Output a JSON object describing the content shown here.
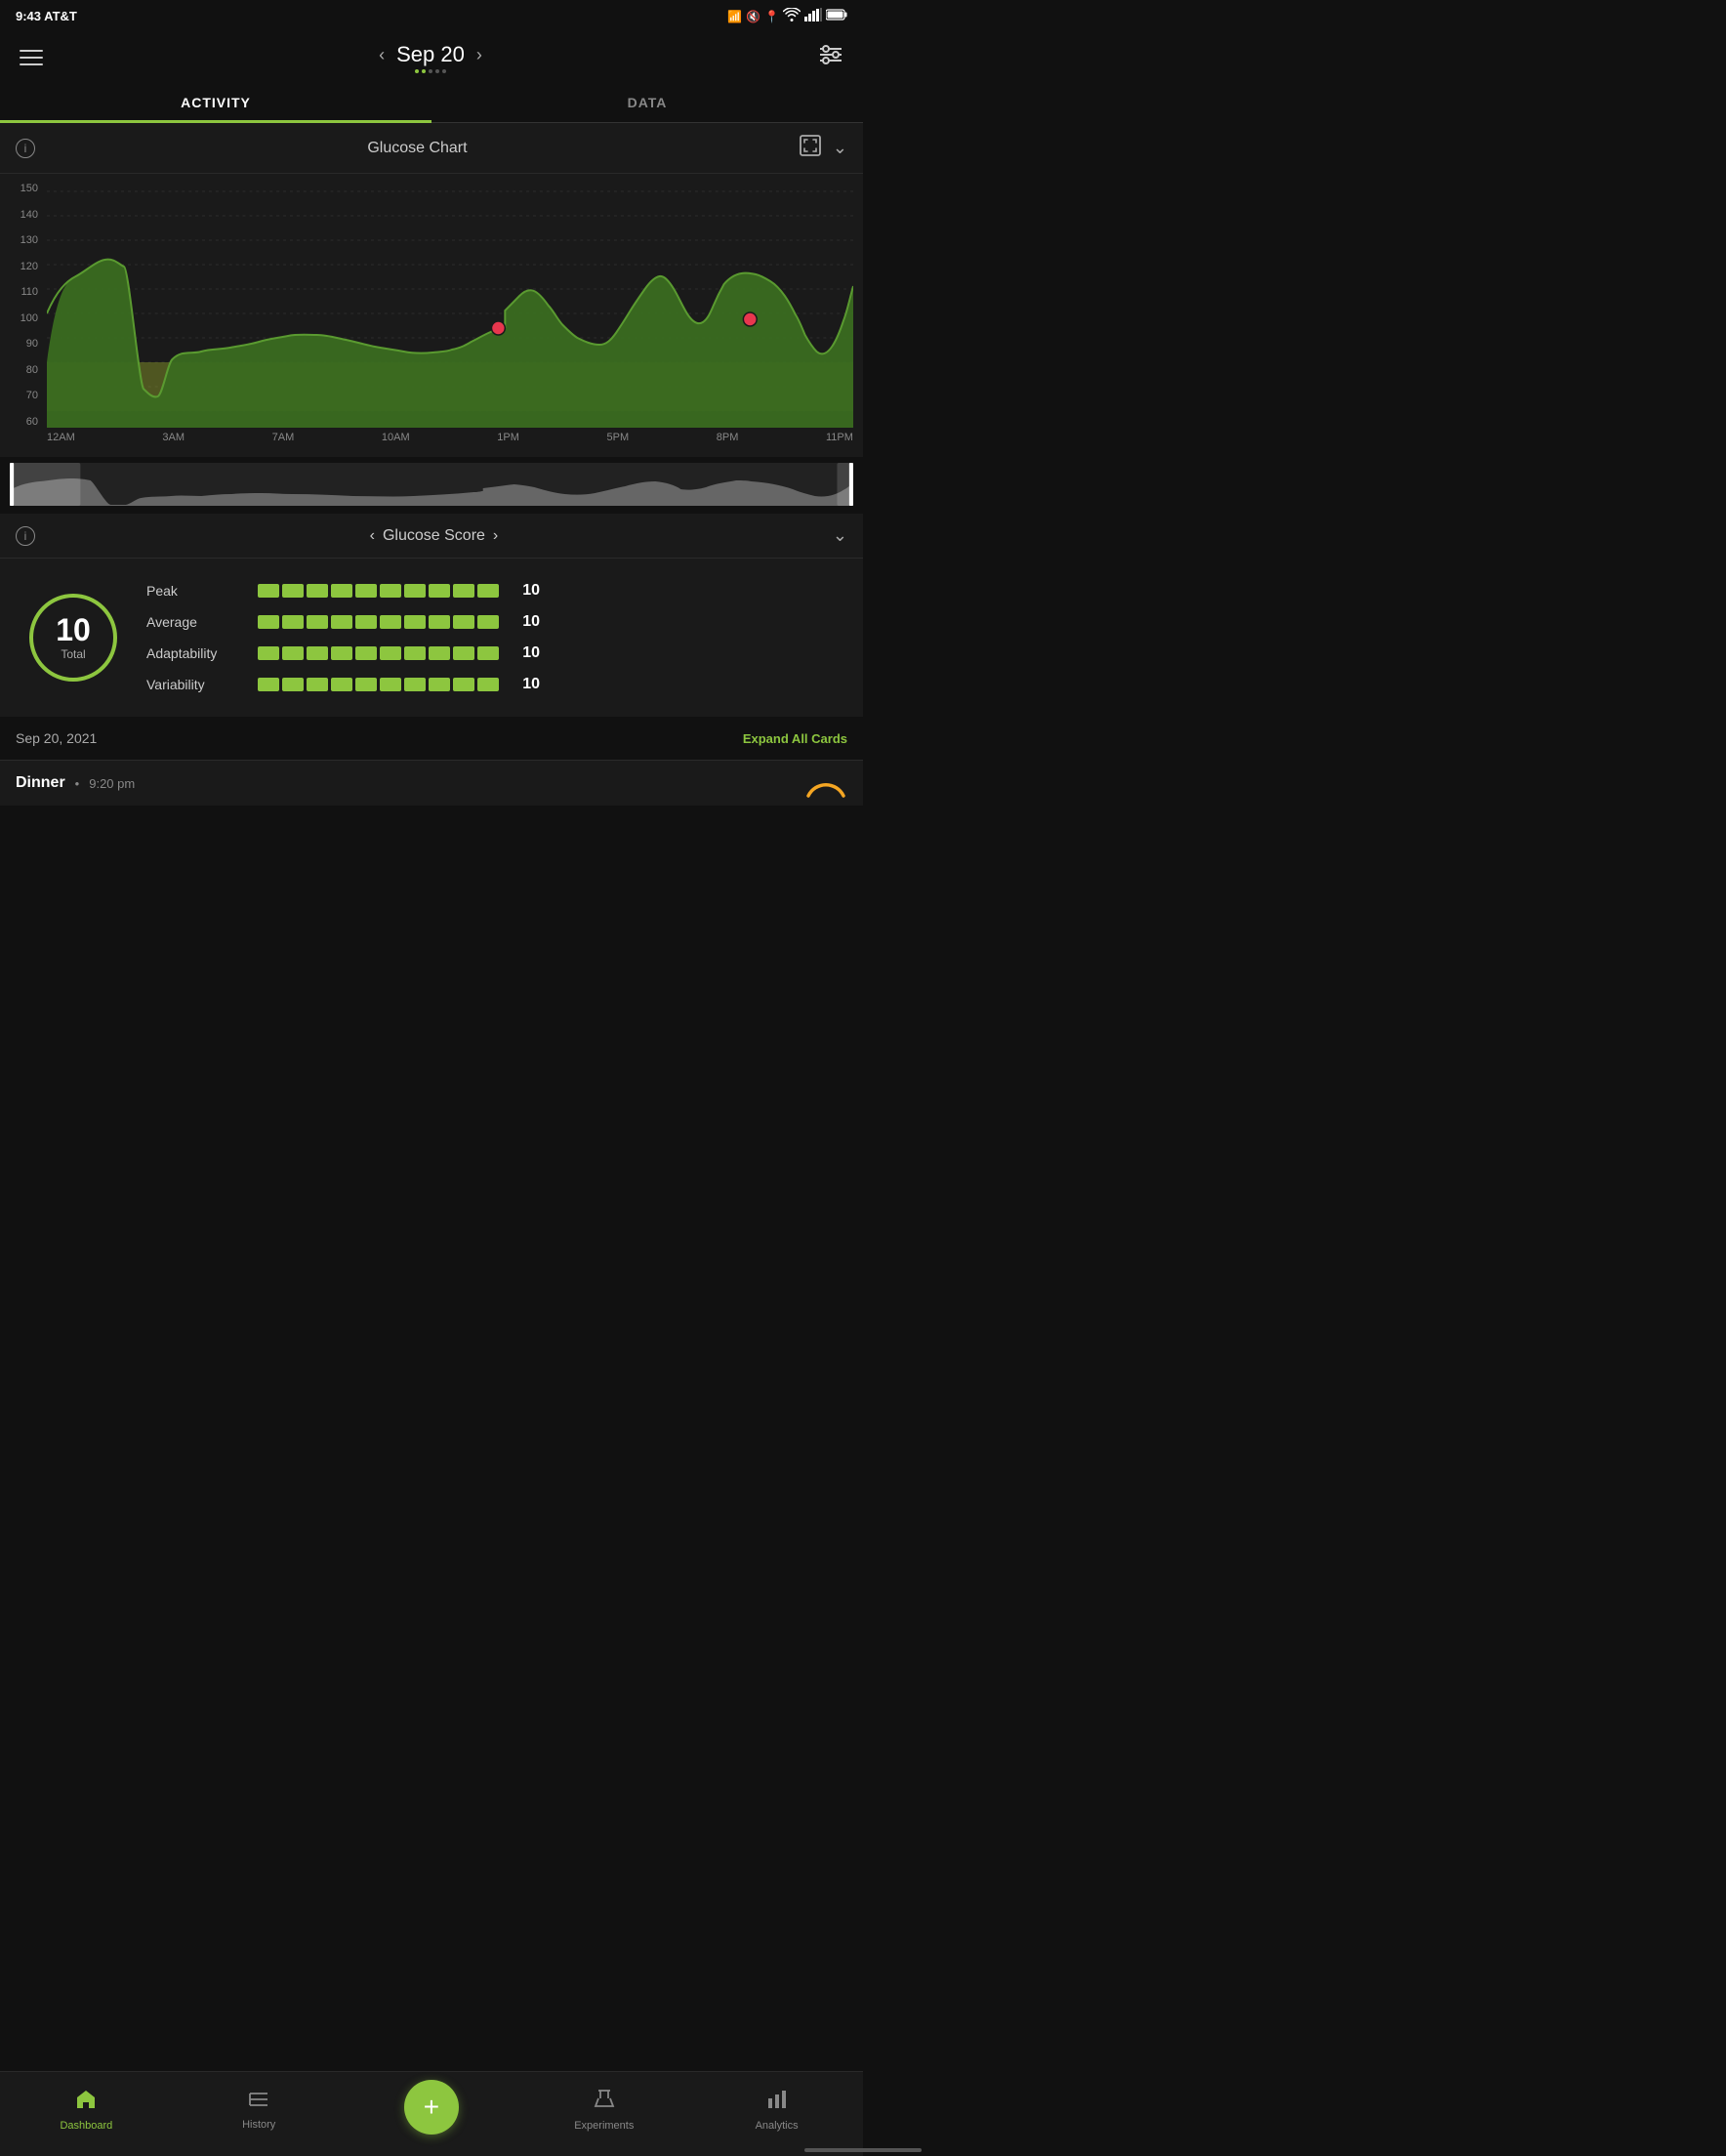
{
  "statusBar": {
    "time": "9:43",
    "carrier": "AT&T",
    "icons": [
      "nfc",
      "mute",
      "location",
      "wifi",
      "signal",
      "battery"
    ]
  },
  "header": {
    "date": "Sep 20",
    "prevArrow": "‹",
    "nextArrow": "›"
  },
  "tabs": [
    {
      "label": "ACTIVITY",
      "active": true
    },
    {
      "label": "DATA",
      "active": false
    }
  ],
  "glucoseChart": {
    "title": "Glucose Chart",
    "yLabels": [
      "60",
      "70",
      "80",
      "90",
      "100",
      "110",
      "120",
      "130",
      "140",
      "150"
    ],
    "xLabels": [
      "12AM",
      "3AM",
      "7AM",
      "10AM",
      "1PM",
      "5PM",
      "8PM",
      "11PM"
    ]
  },
  "glucoseScore": {
    "title": "Glucose Score",
    "totalScore": "10",
    "totalLabel": "Total",
    "metrics": [
      {
        "name": "Peak",
        "bars": 10,
        "value": "10"
      },
      {
        "name": "Average",
        "bars": 10,
        "value": "10"
      },
      {
        "name": "Adaptability",
        "bars": 10,
        "value": "10"
      },
      {
        "name": "Variability",
        "bars": 10,
        "value": "10"
      }
    ]
  },
  "dateDivider": {
    "date": "Sep 20, 2021",
    "expandBtn": "Expand All Cards"
  },
  "cardPeek": {
    "title": "Dinner",
    "time": "9:20 pm"
  },
  "bottomNav": [
    {
      "id": "dashboard",
      "label": "Dashboard",
      "icon": "🏠",
      "active": true
    },
    {
      "id": "history",
      "label": "History",
      "icon": "≡",
      "active": false
    },
    {
      "id": "add",
      "label": "",
      "icon": "+",
      "active": false
    },
    {
      "id": "experiments",
      "label": "Experiments",
      "icon": "⚗",
      "active": false
    },
    {
      "id": "analytics",
      "label": "Analytics",
      "icon": "📊",
      "active": false
    }
  ]
}
